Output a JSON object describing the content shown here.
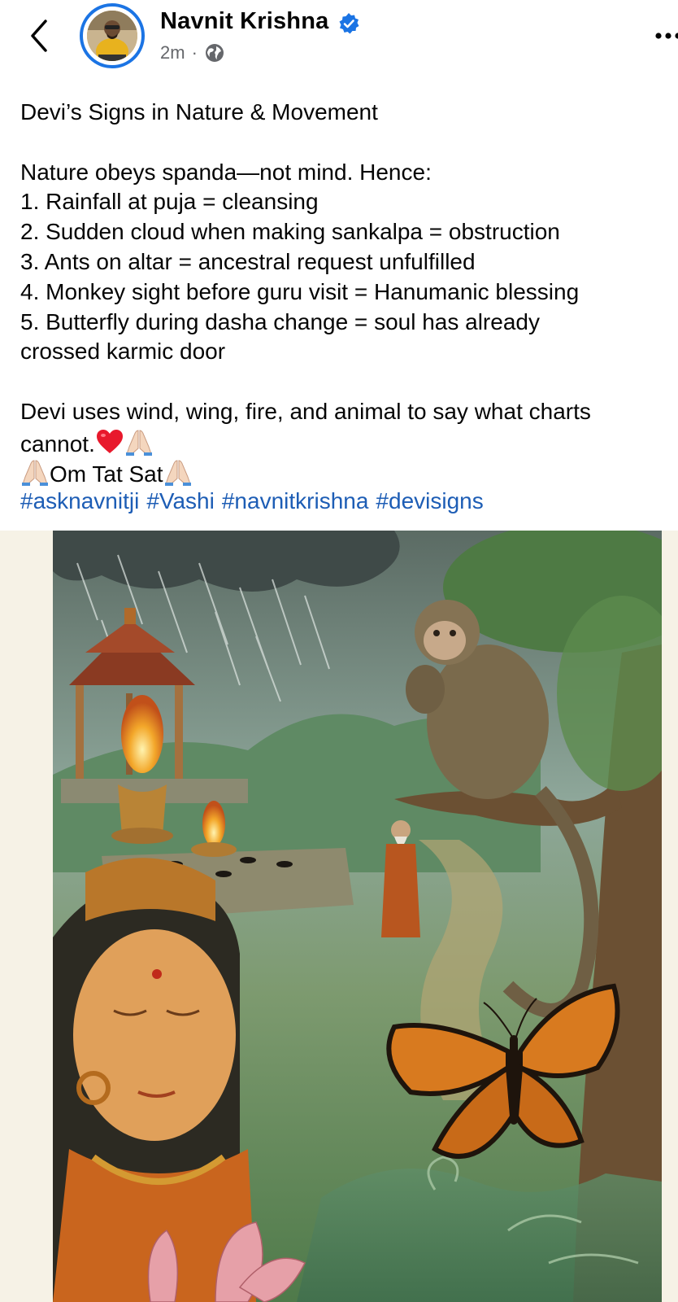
{
  "header": {
    "author_name": "Navnit Krishna",
    "timestamp": "2m",
    "separator": "·",
    "verified": true,
    "privacy_icon": "globe-icon",
    "back_icon": "chevron-left-icon",
    "more_icon": "more-dots-icon"
  },
  "post": {
    "title": "Devi’s Signs in Nature & Movement",
    "intro": "Nature obeys spanda—not mind. Hence:",
    "items": [
      "1. Rainfall at puja = cleansing",
      "2. Sudden cloud when making sankalpa = obstruction",
      "3. Ants on altar = ancestral request unfulfilled",
      "4. Monkey sight before guru visit = Hanumanic blessing",
      "5. Butterfly during dasha change = soul has already",
      "crossed karmic door"
    ],
    "closing_1": "Devi uses wind, wing, fire, and animal to say what charts",
    "closing_2": "cannot.",
    "om_line": "Om Tat Sat",
    "hashtags": [
      "#asknavnitji",
      "#Vashi",
      "#navnitkrishna",
      "#devisigns"
    ],
    "emojis": [
      "red-heart",
      "folded-hands"
    ]
  },
  "colors": {
    "verified_blue": "#1b74e4",
    "hashtag_blue": "#1d5db5",
    "meta_gray": "#65676b"
  }
}
